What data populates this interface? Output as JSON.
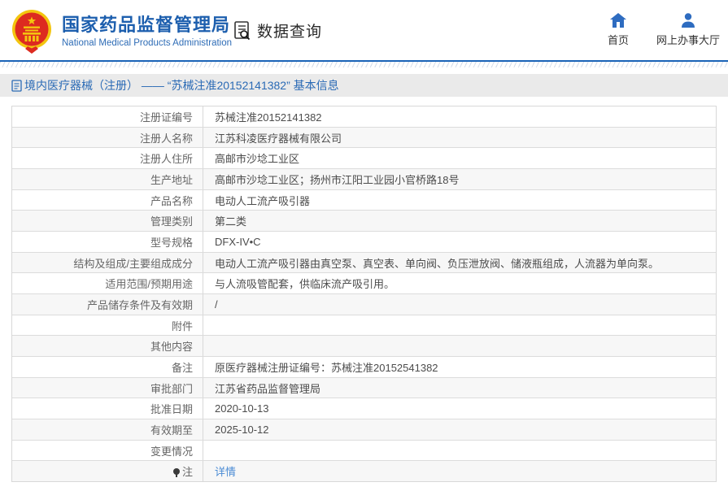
{
  "header": {
    "org_title": "国家药品监督管理局",
    "org_subtitle": "National Medical Products Administration",
    "section_label": "数据查询",
    "nav": [
      {
        "label": "首页",
        "icon": "home-icon"
      },
      {
        "label": "网上办事大厅",
        "icon": "user-icon"
      }
    ]
  },
  "page": {
    "title": "境内医疗器械（注册） —— “苏械注准20152141382” 基本信息"
  },
  "table": {
    "rows": [
      {
        "label": "注册证编号",
        "value": "苏械注准20152141382"
      },
      {
        "label": "注册人名称",
        "value": "江苏科凌医疗器械有限公司"
      },
      {
        "label": "注册人住所",
        "value": "高邮市沙埝工业区"
      },
      {
        "label": "生产地址",
        "value": "高邮市沙埝工业区；扬州市江阳工业园小官桥路18号"
      },
      {
        "label": "产品名称",
        "value": "电动人工流产吸引器"
      },
      {
        "label": "管理类别",
        "value": "第二类"
      },
      {
        "label": "型号规格",
        "value": "DFX-IV•C"
      },
      {
        "label": "结构及组成/主要组成成分",
        "value": "电动人工流产吸引器由真空泵、真空表、单向阀、负压泄放阀、储液瓶组成，人流器为单向泵。"
      },
      {
        "label": "适用范围/预期用途",
        "value": "与人流吸管配套，供临床流产吸引用。"
      },
      {
        "label": "产品储存条件及有效期",
        "value": "/"
      },
      {
        "label": "附件",
        "value": ""
      },
      {
        "label": "其他内容",
        "value": ""
      },
      {
        "label": "备注",
        "value": "原医疗器械注册证编号：苏械注准20152541382"
      },
      {
        "label": "审批部门",
        "value": "江苏省药品监督管理局"
      },
      {
        "label": "批准日期",
        "value": "2020-10-13"
      },
      {
        "label": "有效期至",
        "value": "2025-10-12"
      },
      {
        "label": "变更情况",
        "value": ""
      },
      {
        "label": "注",
        "value": "详情",
        "label_icon": "note-pin-icon",
        "value_link": true
      }
    ]
  },
  "colors": {
    "accent_blue": "#1a63b7",
    "title_blue": "#2a6ab5",
    "link_blue": "#4a8bd4",
    "emblem_red": "#dd2b20",
    "emblem_gold": "#f3c50f",
    "row_alt": "#f7f7f7",
    "table_border": "#d8d8d8"
  }
}
